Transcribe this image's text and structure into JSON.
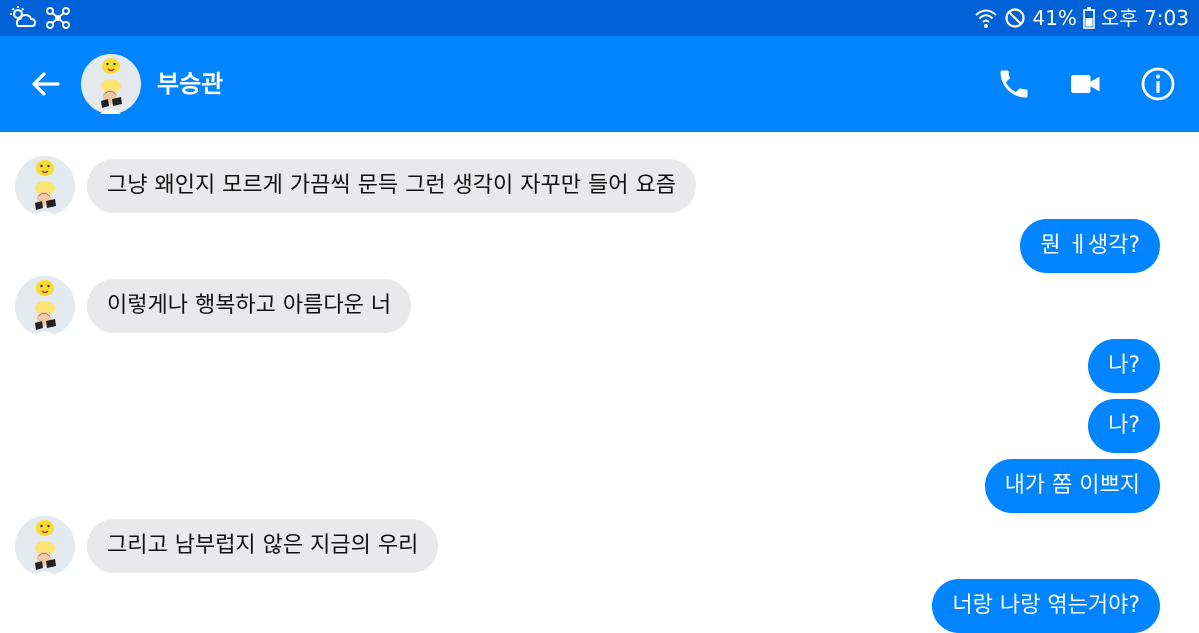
{
  "status_bar": {
    "battery_percent": "41%",
    "time": "오후 7:03",
    "left_icons": [
      "weather-icon",
      "network-icon"
    ],
    "right_icons": [
      "wifi-icon",
      "do-not-disturb-icon",
      "battery-icon"
    ]
  },
  "header": {
    "contact_name": "부승관",
    "icons": [
      "back-arrow-icon",
      "phone-icon",
      "video-camera-icon",
      "info-icon"
    ]
  },
  "messages": [
    {
      "side": "incoming",
      "text": "그냥 왜인지 모르게 가끔씩 문득  그런 생각이 자꾸만 들어 요즘"
    },
    {
      "side": "outgoing",
      "text": "뭔 ㅔ생각?"
    },
    {
      "side": "incoming",
      "text": "이렇게나 행복하고 아름다운 너"
    },
    {
      "side": "outgoing",
      "text": "나?"
    },
    {
      "side": "outgoing",
      "text": "나?"
    },
    {
      "side": "outgoing",
      "text": "내가 쫌 이쁘지"
    },
    {
      "side": "incoming",
      "text": "그리고 남부럽지 않은 지금의 우리"
    },
    {
      "side": "outgoing",
      "text": "너랑 나랑 엮는거야?"
    }
  ],
  "colors": {
    "status_bar": "#0062d6",
    "header": "#0084ff",
    "outgoing_bubble": "#0084ff",
    "incoming_bubble": "#e9e9eb"
  }
}
